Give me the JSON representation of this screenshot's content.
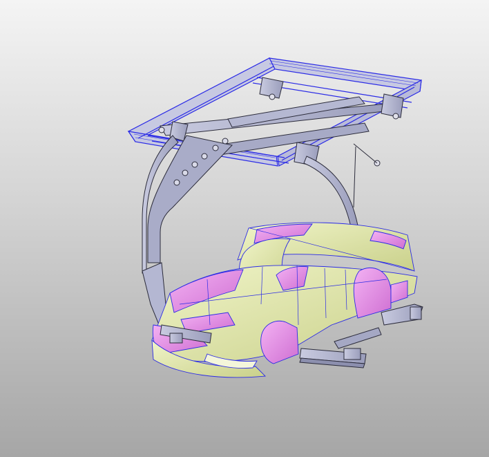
{
  "viewport": {
    "background_top": "#f4f4f4",
    "background_bottom": "#a6a6a6"
  },
  "model": {
    "selected_part": "overhead-rail-frame",
    "selection_color": "#2a2ae6",
    "colors": {
      "frame": "#b4b7d2",
      "frame_dark": "#8c8fae",
      "body_yellow": "#dfe6a8",
      "body_magenta": "#e48be6",
      "outline": "#2b2b3a"
    },
    "parts": [
      "overhead-rail-frame",
      "trolley-carriage",
      "c-hanger-arm",
      "car-body-shell",
      "support-skid"
    ]
  }
}
